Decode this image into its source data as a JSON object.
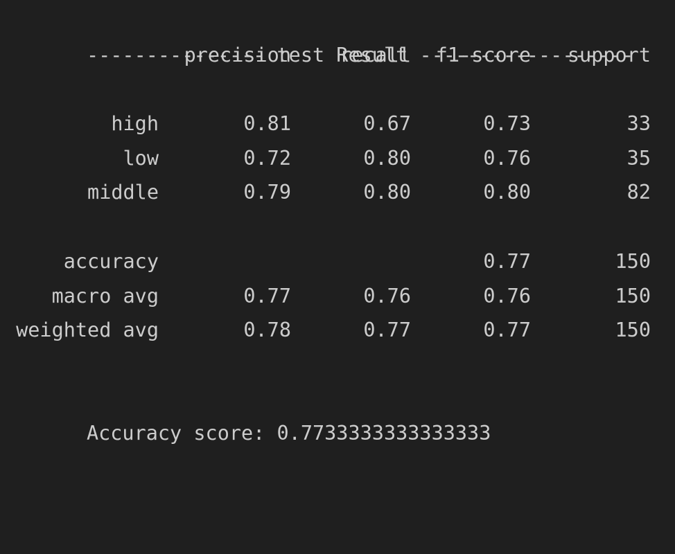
{
  "header": {
    "dashes_left": "---------------",
    "title": "test Result",
    "dashes_right": "------------------"
  },
  "columns": {
    "precision": "precision",
    "recall": "recall",
    "f1": "f1-score",
    "support": "support"
  },
  "class_rows": [
    {
      "label": "high",
      "precision": "0.81",
      "recall": "0.67",
      "f1": "0.73",
      "support": "33"
    },
    {
      "label": "low",
      "precision": "0.72",
      "recall": "0.80",
      "f1": "0.76",
      "support": "35"
    },
    {
      "label": "middle",
      "precision": "0.79",
      "recall": "0.80",
      "f1": "0.80",
      "support": "82"
    }
  ],
  "summary_rows": [
    {
      "label": "accuracy",
      "precision": "",
      "recall": "",
      "f1": "0.77",
      "support": "150"
    },
    {
      "label": "macro avg",
      "precision": "0.77",
      "recall": "0.76",
      "f1": "0.76",
      "support": "150"
    },
    {
      "label": "weighted avg",
      "precision": "0.78",
      "recall": "0.77",
      "f1": "0.77",
      "support": "150"
    }
  ],
  "accuracy_score": {
    "label": "Accuracy score:",
    "value": "0.7733333333333333"
  }
}
